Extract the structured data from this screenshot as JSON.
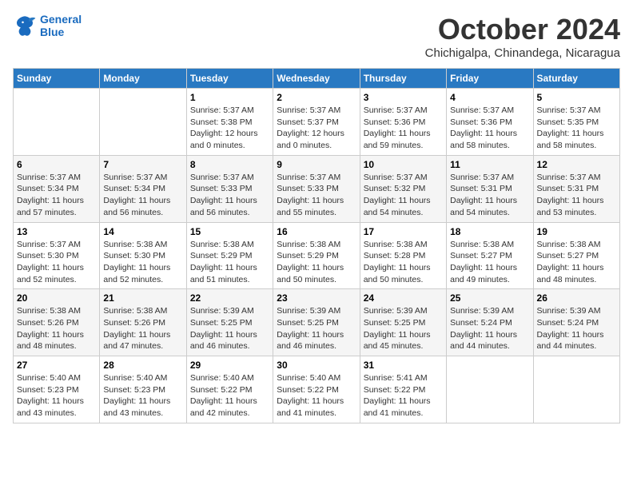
{
  "header": {
    "logo_line1": "General",
    "logo_line2": "Blue",
    "month_title": "October 2024",
    "subtitle": "Chichigalpa, Chinandega, Nicaragua"
  },
  "weekdays": [
    "Sunday",
    "Monday",
    "Tuesday",
    "Wednesday",
    "Thursday",
    "Friday",
    "Saturday"
  ],
  "weeks": [
    [
      {
        "day": "",
        "info": ""
      },
      {
        "day": "",
        "info": ""
      },
      {
        "day": "1",
        "info": "Sunrise: 5:37 AM\nSunset: 5:38 PM\nDaylight: 12 hours\nand 0 minutes."
      },
      {
        "day": "2",
        "info": "Sunrise: 5:37 AM\nSunset: 5:37 PM\nDaylight: 12 hours\nand 0 minutes."
      },
      {
        "day": "3",
        "info": "Sunrise: 5:37 AM\nSunset: 5:36 PM\nDaylight: 11 hours\nand 59 minutes."
      },
      {
        "day": "4",
        "info": "Sunrise: 5:37 AM\nSunset: 5:36 PM\nDaylight: 11 hours\nand 58 minutes."
      },
      {
        "day": "5",
        "info": "Sunrise: 5:37 AM\nSunset: 5:35 PM\nDaylight: 11 hours\nand 58 minutes."
      }
    ],
    [
      {
        "day": "6",
        "info": "Sunrise: 5:37 AM\nSunset: 5:34 PM\nDaylight: 11 hours\nand 57 minutes."
      },
      {
        "day": "7",
        "info": "Sunrise: 5:37 AM\nSunset: 5:34 PM\nDaylight: 11 hours\nand 56 minutes."
      },
      {
        "day": "8",
        "info": "Sunrise: 5:37 AM\nSunset: 5:33 PM\nDaylight: 11 hours\nand 56 minutes."
      },
      {
        "day": "9",
        "info": "Sunrise: 5:37 AM\nSunset: 5:33 PM\nDaylight: 11 hours\nand 55 minutes."
      },
      {
        "day": "10",
        "info": "Sunrise: 5:37 AM\nSunset: 5:32 PM\nDaylight: 11 hours\nand 54 minutes."
      },
      {
        "day": "11",
        "info": "Sunrise: 5:37 AM\nSunset: 5:31 PM\nDaylight: 11 hours\nand 54 minutes."
      },
      {
        "day": "12",
        "info": "Sunrise: 5:37 AM\nSunset: 5:31 PM\nDaylight: 11 hours\nand 53 minutes."
      }
    ],
    [
      {
        "day": "13",
        "info": "Sunrise: 5:37 AM\nSunset: 5:30 PM\nDaylight: 11 hours\nand 52 minutes."
      },
      {
        "day": "14",
        "info": "Sunrise: 5:38 AM\nSunset: 5:30 PM\nDaylight: 11 hours\nand 52 minutes."
      },
      {
        "day": "15",
        "info": "Sunrise: 5:38 AM\nSunset: 5:29 PM\nDaylight: 11 hours\nand 51 minutes."
      },
      {
        "day": "16",
        "info": "Sunrise: 5:38 AM\nSunset: 5:29 PM\nDaylight: 11 hours\nand 50 minutes."
      },
      {
        "day": "17",
        "info": "Sunrise: 5:38 AM\nSunset: 5:28 PM\nDaylight: 11 hours\nand 50 minutes."
      },
      {
        "day": "18",
        "info": "Sunrise: 5:38 AM\nSunset: 5:27 PM\nDaylight: 11 hours\nand 49 minutes."
      },
      {
        "day": "19",
        "info": "Sunrise: 5:38 AM\nSunset: 5:27 PM\nDaylight: 11 hours\nand 48 minutes."
      }
    ],
    [
      {
        "day": "20",
        "info": "Sunrise: 5:38 AM\nSunset: 5:26 PM\nDaylight: 11 hours\nand 48 minutes."
      },
      {
        "day": "21",
        "info": "Sunrise: 5:38 AM\nSunset: 5:26 PM\nDaylight: 11 hours\nand 47 minutes."
      },
      {
        "day": "22",
        "info": "Sunrise: 5:39 AM\nSunset: 5:25 PM\nDaylight: 11 hours\nand 46 minutes."
      },
      {
        "day": "23",
        "info": "Sunrise: 5:39 AM\nSunset: 5:25 PM\nDaylight: 11 hours\nand 46 minutes."
      },
      {
        "day": "24",
        "info": "Sunrise: 5:39 AM\nSunset: 5:25 PM\nDaylight: 11 hours\nand 45 minutes."
      },
      {
        "day": "25",
        "info": "Sunrise: 5:39 AM\nSunset: 5:24 PM\nDaylight: 11 hours\nand 44 minutes."
      },
      {
        "day": "26",
        "info": "Sunrise: 5:39 AM\nSunset: 5:24 PM\nDaylight: 11 hours\nand 44 minutes."
      }
    ],
    [
      {
        "day": "27",
        "info": "Sunrise: 5:40 AM\nSunset: 5:23 PM\nDaylight: 11 hours\nand 43 minutes."
      },
      {
        "day": "28",
        "info": "Sunrise: 5:40 AM\nSunset: 5:23 PM\nDaylight: 11 hours\nand 43 minutes."
      },
      {
        "day": "29",
        "info": "Sunrise: 5:40 AM\nSunset: 5:22 PM\nDaylight: 11 hours\nand 42 minutes."
      },
      {
        "day": "30",
        "info": "Sunrise: 5:40 AM\nSunset: 5:22 PM\nDaylight: 11 hours\nand 41 minutes."
      },
      {
        "day": "31",
        "info": "Sunrise: 5:41 AM\nSunset: 5:22 PM\nDaylight: 11 hours\nand 41 minutes."
      },
      {
        "day": "",
        "info": ""
      },
      {
        "day": "",
        "info": ""
      }
    ]
  ]
}
